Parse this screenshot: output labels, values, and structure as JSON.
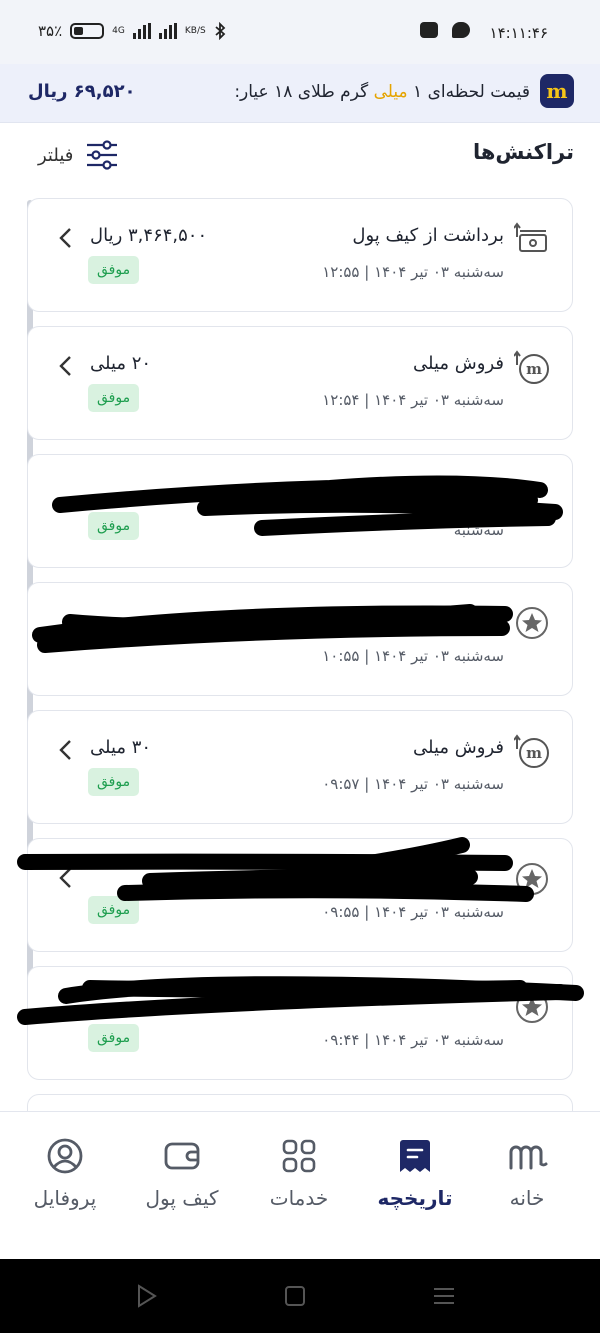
{
  "status_bar": {
    "time": "۱۴:۱۱:۴۶",
    "battery": "۳۵٪",
    "network": "4G",
    "speed_unit": "KB/S"
  },
  "price_banner": {
    "label_prefix": "قیمت لحظه‌ای ۱",
    "label_highlight": "میلی",
    "label_suffix": "گرم طلای ۱۸ عیار:",
    "value": "۶۹,۵۲۰ ریال"
  },
  "header": {
    "title": "تراکنش‌ها",
    "filter_label": "فیلتر"
  },
  "transactions": [
    {
      "icon": "wallet-withdraw-icon",
      "title": "برداشت از کیف پول",
      "date": "سه‌شنبه ۰۳ تیر ۱۴۰۴ | ۱۲:۵۵",
      "amount": "۳,۴۶۴,۵۰۰ ریال",
      "status": "موفق"
    },
    {
      "icon": "mili-sell-icon",
      "title": "فروش میلی",
      "date": "سه‌شنبه ۰۳ تیر ۱۴۰۴ | ۱۲:۵۴",
      "amount": "۲۰ میلی",
      "status": "موفق"
    },
    {
      "icon": "redacted-icon",
      "title": "",
      "date": "سه‌شنبه",
      "amount": "",
      "status": "موفق"
    },
    {
      "icon": "star-icon",
      "title": "",
      "date": "سه‌شنبه ۰۳ تیر ۱۴۰۴ | ۱۰:۵۵",
      "amount": "",
      "status": ""
    },
    {
      "icon": "mili-sell-icon",
      "title": "فروش میلی",
      "date": "سه‌شنبه ۰۳ تیر ۱۴۰۴ | ۰۹:۵۷",
      "amount": "۳۰ میلی",
      "status": "موفق"
    },
    {
      "icon": "star-icon",
      "title": "",
      "date": "سه‌شنبه ۰۳ تیر ۱۴۰۴ | ۰۹:۵۵",
      "amount": "",
      "status": "موفق"
    },
    {
      "icon": "star-icon",
      "title": "",
      "date": "سه‌شنبه ۰۳ تیر ۱۴۰۴ | ۰۹:۴۴",
      "amount": "",
      "status": "موفق"
    }
  ],
  "bottom_nav": [
    {
      "key": "home",
      "label": "خانه",
      "icon": "home-logo-icon",
      "active": false
    },
    {
      "key": "history",
      "label": "تاریخچه",
      "icon": "history-icon",
      "active": true
    },
    {
      "key": "services",
      "label": "خدمات",
      "icon": "services-grid-icon",
      "active": false
    },
    {
      "key": "wallet",
      "label": "کیف پول",
      "icon": "wallet-icon",
      "active": false
    },
    {
      "key": "profile",
      "label": "پروفایل",
      "icon": "profile-icon",
      "active": false
    }
  ],
  "colors": {
    "brand_navy": "#1e2866",
    "gold": "#e5a400",
    "success_bg": "#d9f2e0",
    "success_text": "#1e9e4f"
  }
}
